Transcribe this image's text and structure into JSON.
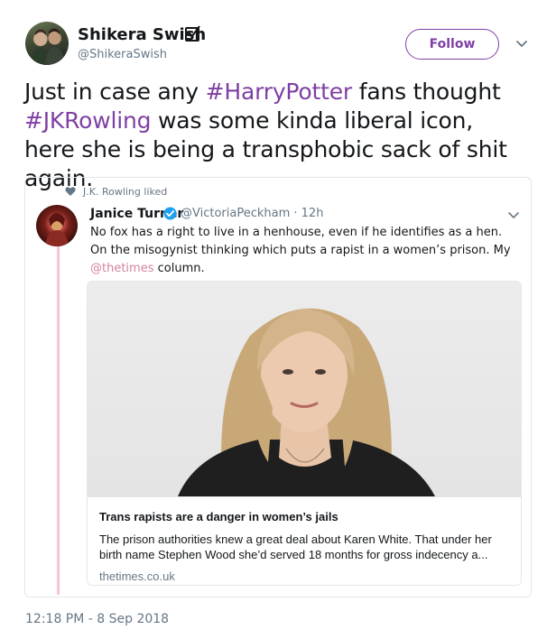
{
  "author": {
    "name": "Shikera Swish",
    "handle": "@ShikeraSwish",
    "follow_label": "Follow"
  },
  "tweet": {
    "text_parts": [
      {
        "text": "Just in case any ",
        "type": "text"
      },
      {
        "text": "#HarryPotter",
        "type": "hashtag"
      },
      {
        "text": " fans thought ",
        "type": "text"
      },
      {
        "text": "#JKRowling",
        "type": "hashtag"
      },
      {
        "text": " was some kinda liberal icon, here she is being a transphobic sack of shit again.",
        "type": "text"
      }
    ],
    "timestamp": "12:18 PM - 8 Sep 2018"
  },
  "quoted": {
    "liked_by": "J.K. Rowling liked",
    "name": "Janice Turner",
    "handle_time": "@VictoriaPeckham · 12h",
    "text_before": "No fox has a right to live in a henhouse, even if he identifies as a hen. On the misogynist thinking which puts a rapist in a women’s prison. My ",
    "mention": "@thetimes",
    "text_after": " column.",
    "card": {
      "title": "Trans rapists are a danger in women’s jails",
      "description": "The prison authorities knew a great deal about Karen White. That under her birth name Stephen Wood she’d served 18 months for gross indecency a...",
      "domain": "thetimes.co.uk"
    }
  },
  "icons": {
    "verified_author": "checkbox-check-icon",
    "verified_quoted": "verified-badge-icon",
    "caret": "chevron-down-icon",
    "heart": "heart-icon"
  },
  "colors": {
    "accent": "#7f3fa5",
    "mention": "#d3839b",
    "muted": "#657786",
    "thread_line": "#f3c7d3",
    "verified_blue": "#1da1f2"
  }
}
